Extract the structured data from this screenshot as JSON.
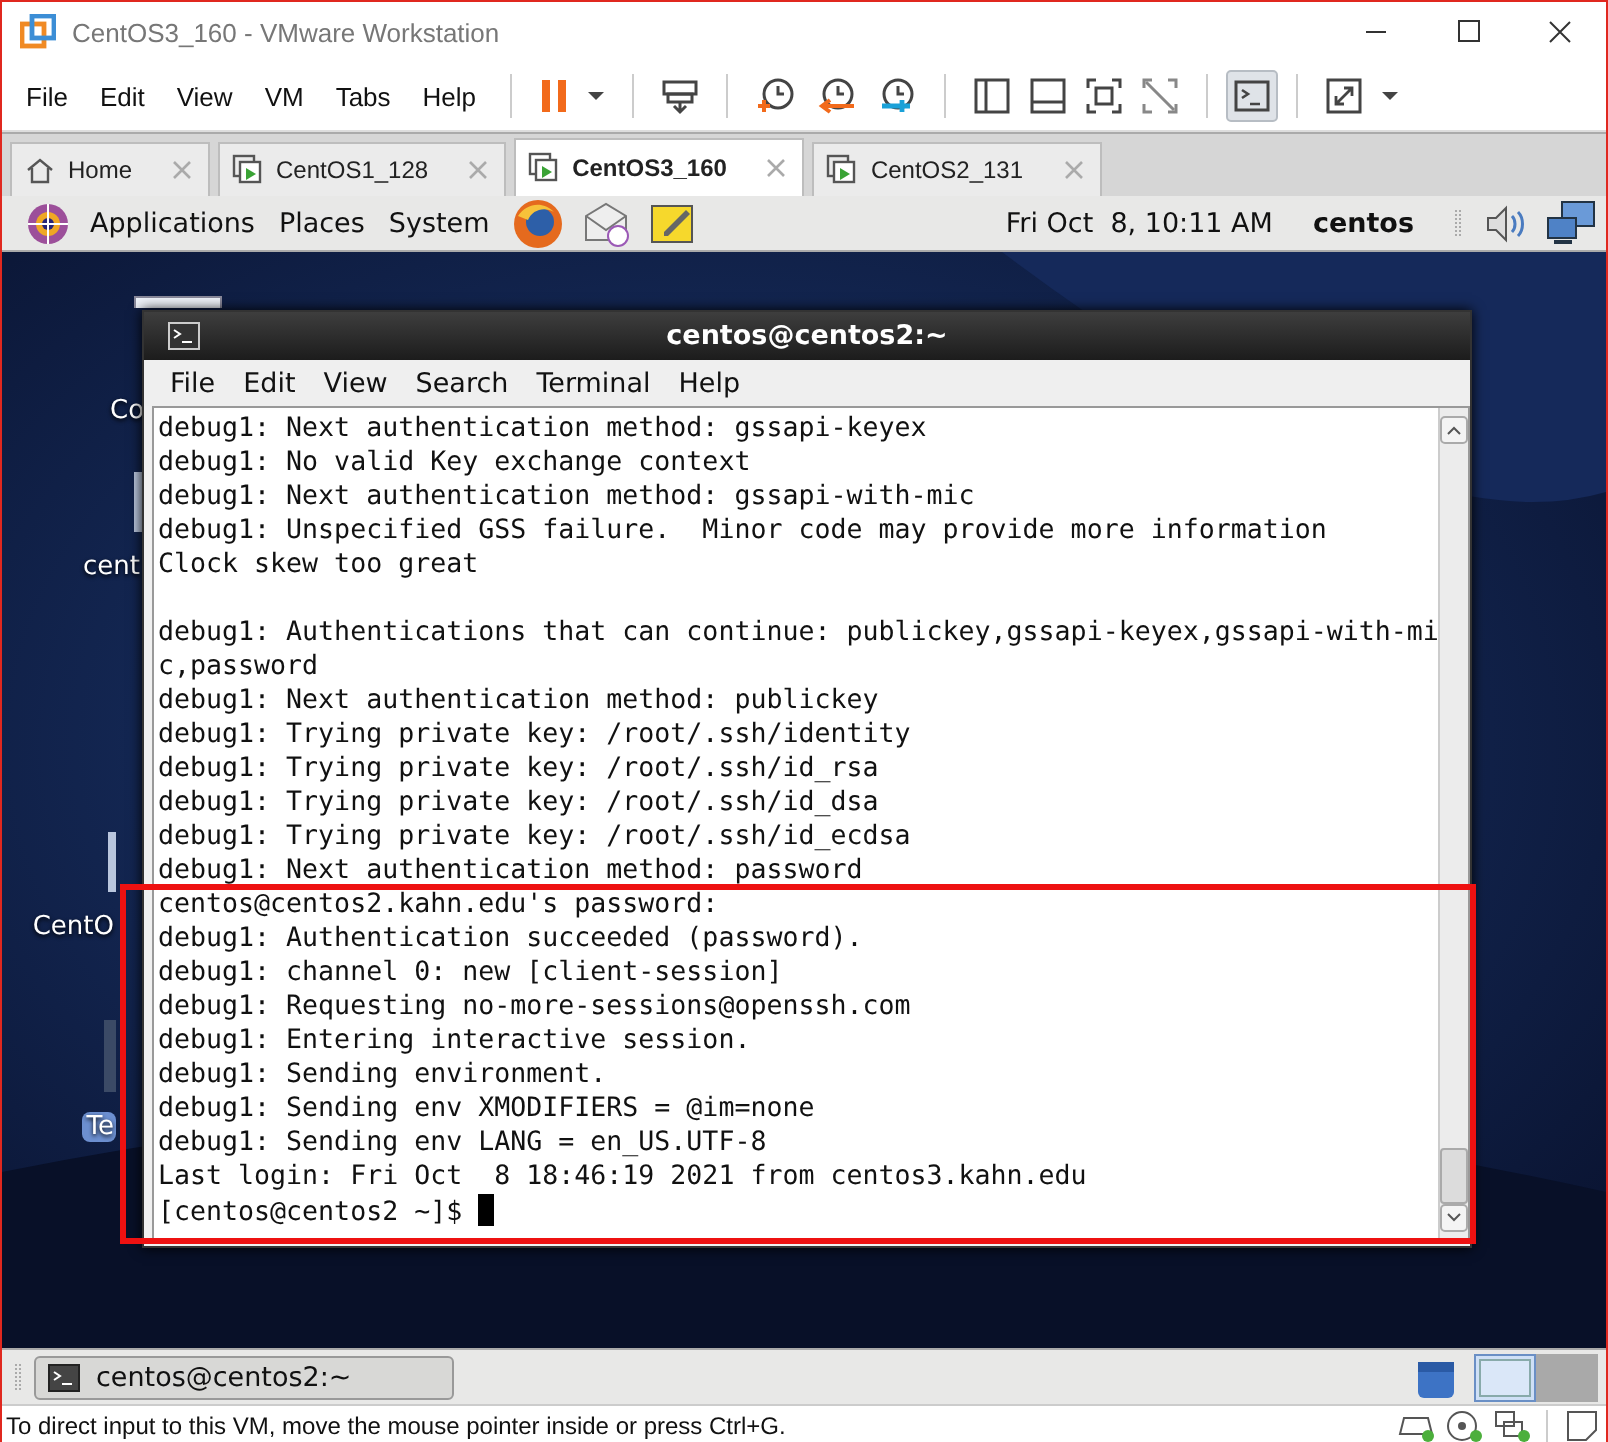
{
  "window": {
    "title": "CentOS3_160 - VMware Workstation"
  },
  "menu": [
    "File",
    "Edit",
    "View",
    "VM",
    "Tabs",
    "Help"
  ],
  "tabs": [
    {
      "label": "Home",
      "kind": "home",
      "selected": false
    },
    {
      "label": "CentOS1_128",
      "kind": "vm",
      "selected": false
    },
    {
      "label": "CentOS3_160",
      "kind": "vm",
      "selected": true
    },
    {
      "label": "CentOS2_131",
      "kind": "vm",
      "selected": false
    }
  ],
  "panel": {
    "menus": [
      "Applications",
      "Places",
      "System"
    ],
    "clock": "Fri Oct  8, 10:11 AM",
    "user": "centos"
  },
  "desktop_icons": [
    {
      "label": "Co"
    },
    {
      "label": "cent"
    },
    {
      "label": "CentO"
    },
    {
      "label": "Te"
    }
  ],
  "terminal": {
    "title": "centos@centos2:~",
    "menu": [
      "File",
      "Edit",
      "View",
      "Search",
      "Terminal",
      "Help"
    ],
    "blocks": [
      [
        "debug1: Next authentication method: gssapi-keyex",
        "debug1: No valid Key exchange context",
        "debug1: Next authentication method: gssapi-with-mic",
        "debug1: Unspecified GSS failure.  Minor code may provide more information",
        "Clock skew too great"
      ],
      [
        "debug1: Authentications that can continue: publickey,gssapi-keyex,gssapi-with-mi",
        "c,password",
        "debug1: Next authentication method: publickey",
        "debug1: Trying private key: /root/.ssh/identity",
        "debug1: Trying private key: /root/.ssh/id_rsa",
        "debug1: Trying private key: /root/.ssh/id_dsa",
        "debug1: Trying private key: /root/.ssh/id_ecdsa",
        "debug1: Next authentication method: password",
        "centos@centos2.kahn.edu's password:",
        "debug1: Authentication succeeded (password).",
        "debug1: channel 0: new [client-session]",
        "debug1: Requesting no-more-sessions@openssh.com",
        "debug1: Entering interactive session.",
        "debug1: Sending environment.",
        "debug1: Sending env XMODIFIERS = @im=none",
        "debug1: Sending env LANG = en_US.UTF-8",
        "Last login: Fri Oct  8 18:46:19 2021 from centos3.kahn.edu"
      ]
    ],
    "prompt": "[centos@centos2 ~]$ "
  },
  "taskbar": {
    "items": [
      {
        "label": "centos@centos2:~"
      }
    ]
  },
  "status_bar": {
    "text": "To direct input to this VM, move the mouse pointer inside or press Ctrl+G."
  }
}
